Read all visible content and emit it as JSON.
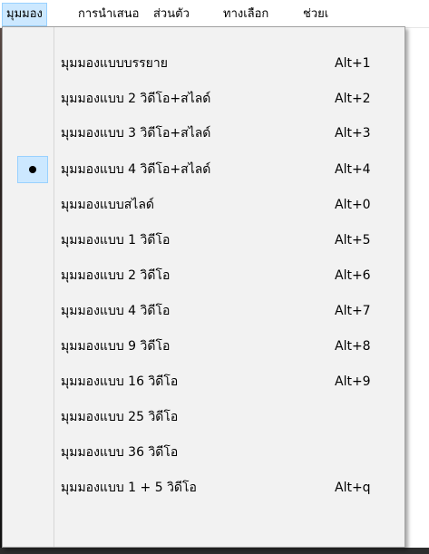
{
  "menubar": {
    "items": [
      "มุมมอง",
      "การนำเสนอ",
      "ส่วนตัว",
      "ทางเลือก",
      "ช่วยเ"
    ]
  },
  "menu": {
    "items": [
      {
        "label": "มุมมองแบบบรรยาย",
        "shortcut": "Alt+1",
        "checked": false
      },
      {
        "label": "มุมมองแบบ 2 วิดีโอ+สไลด์",
        "shortcut": "Alt+2",
        "checked": false
      },
      {
        "label": "มุมมองแบบ 3 วิดีโอ+สไลด์",
        "shortcut": "Alt+3",
        "checked": false
      },
      {
        "label": "มุมมองแบบ 4 วิดีโอ+สไลด์",
        "shortcut": "Alt+4",
        "checked": true
      },
      {
        "label": "มุมมองแบบสไลด์",
        "shortcut": "Alt+0",
        "checked": false
      },
      {
        "label": "มุมมองแบบ 1 วิดีโอ",
        "shortcut": "Alt+5",
        "checked": false
      },
      {
        "label": "มุมมองแบบ 2 วิดีโอ",
        "shortcut": "Alt+6",
        "checked": false
      },
      {
        "label": "มุมมองแบบ 4 วิดีโอ",
        "shortcut": "Alt+7",
        "checked": false
      },
      {
        "label": "มุมมองแบบ 9 วิดีโอ",
        "shortcut": "Alt+8",
        "checked": false
      },
      {
        "label": "มุมมองแบบ 16 วิดีโอ",
        "shortcut": "Alt+9",
        "checked": false
      },
      {
        "label": "มุมมองแบบ 25 วิดีโอ",
        "shortcut": "",
        "checked": false
      },
      {
        "label": "มุมมองแบบ 36 วิดีโอ",
        "shortcut": "",
        "checked": false
      },
      {
        "label": "มุมมองแบบ 1 + 5 วิดีโอ",
        "shortcut": "Alt+q",
        "checked": false
      }
    ]
  },
  "colors": {
    "highlight": "#cce8ff",
    "highlight_border": "#99d1ff",
    "menu_bg": "#f2f2f2"
  }
}
